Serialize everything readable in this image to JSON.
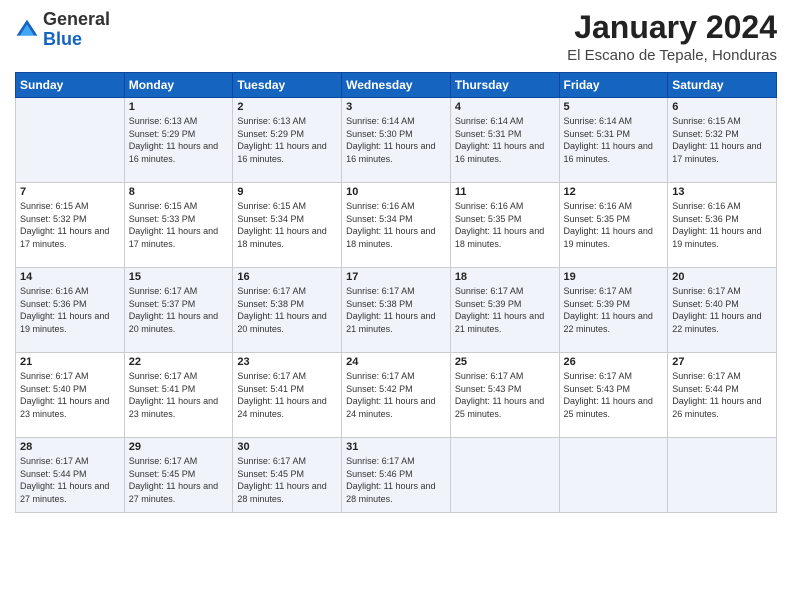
{
  "header": {
    "logo": {
      "general": "General",
      "blue": "Blue"
    },
    "title": "January 2024",
    "location": "El Escano de Tepale, Honduras"
  },
  "calendar": {
    "days_of_week": [
      "Sunday",
      "Monday",
      "Tuesday",
      "Wednesday",
      "Thursday",
      "Friday",
      "Saturday"
    ],
    "weeks": [
      [
        {
          "day": "",
          "sunrise": "",
          "sunset": "",
          "daylight": ""
        },
        {
          "day": "1",
          "sunrise": "Sunrise: 6:13 AM",
          "sunset": "Sunset: 5:29 PM",
          "daylight": "Daylight: 11 hours and 16 minutes."
        },
        {
          "day": "2",
          "sunrise": "Sunrise: 6:13 AM",
          "sunset": "Sunset: 5:29 PM",
          "daylight": "Daylight: 11 hours and 16 minutes."
        },
        {
          "day": "3",
          "sunrise": "Sunrise: 6:14 AM",
          "sunset": "Sunset: 5:30 PM",
          "daylight": "Daylight: 11 hours and 16 minutes."
        },
        {
          "day": "4",
          "sunrise": "Sunrise: 6:14 AM",
          "sunset": "Sunset: 5:31 PM",
          "daylight": "Daylight: 11 hours and 16 minutes."
        },
        {
          "day": "5",
          "sunrise": "Sunrise: 6:14 AM",
          "sunset": "Sunset: 5:31 PM",
          "daylight": "Daylight: 11 hours and 16 minutes."
        },
        {
          "day": "6",
          "sunrise": "Sunrise: 6:15 AM",
          "sunset": "Sunset: 5:32 PM",
          "daylight": "Daylight: 11 hours and 17 minutes."
        }
      ],
      [
        {
          "day": "7",
          "sunrise": "Sunrise: 6:15 AM",
          "sunset": "Sunset: 5:32 PM",
          "daylight": "Daylight: 11 hours and 17 minutes."
        },
        {
          "day": "8",
          "sunrise": "Sunrise: 6:15 AM",
          "sunset": "Sunset: 5:33 PM",
          "daylight": "Daylight: 11 hours and 17 minutes."
        },
        {
          "day": "9",
          "sunrise": "Sunrise: 6:15 AM",
          "sunset": "Sunset: 5:34 PM",
          "daylight": "Daylight: 11 hours and 18 minutes."
        },
        {
          "day": "10",
          "sunrise": "Sunrise: 6:16 AM",
          "sunset": "Sunset: 5:34 PM",
          "daylight": "Daylight: 11 hours and 18 minutes."
        },
        {
          "day": "11",
          "sunrise": "Sunrise: 6:16 AM",
          "sunset": "Sunset: 5:35 PM",
          "daylight": "Daylight: 11 hours and 18 minutes."
        },
        {
          "day": "12",
          "sunrise": "Sunrise: 6:16 AM",
          "sunset": "Sunset: 5:35 PM",
          "daylight": "Daylight: 11 hours and 19 minutes."
        },
        {
          "day": "13",
          "sunrise": "Sunrise: 6:16 AM",
          "sunset": "Sunset: 5:36 PM",
          "daylight": "Daylight: 11 hours and 19 minutes."
        }
      ],
      [
        {
          "day": "14",
          "sunrise": "Sunrise: 6:16 AM",
          "sunset": "Sunset: 5:36 PM",
          "daylight": "Daylight: 11 hours and 19 minutes."
        },
        {
          "day": "15",
          "sunrise": "Sunrise: 6:17 AM",
          "sunset": "Sunset: 5:37 PM",
          "daylight": "Daylight: 11 hours and 20 minutes."
        },
        {
          "day": "16",
          "sunrise": "Sunrise: 6:17 AM",
          "sunset": "Sunset: 5:38 PM",
          "daylight": "Daylight: 11 hours and 20 minutes."
        },
        {
          "day": "17",
          "sunrise": "Sunrise: 6:17 AM",
          "sunset": "Sunset: 5:38 PM",
          "daylight": "Daylight: 11 hours and 21 minutes."
        },
        {
          "day": "18",
          "sunrise": "Sunrise: 6:17 AM",
          "sunset": "Sunset: 5:39 PM",
          "daylight": "Daylight: 11 hours and 21 minutes."
        },
        {
          "day": "19",
          "sunrise": "Sunrise: 6:17 AM",
          "sunset": "Sunset: 5:39 PM",
          "daylight": "Daylight: 11 hours and 22 minutes."
        },
        {
          "day": "20",
          "sunrise": "Sunrise: 6:17 AM",
          "sunset": "Sunset: 5:40 PM",
          "daylight": "Daylight: 11 hours and 22 minutes."
        }
      ],
      [
        {
          "day": "21",
          "sunrise": "Sunrise: 6:17 AM",
          "sunset": "Sunset: 5:40 PM",
          "daylight": "Daylight: 11 hours and 23 minutes."
        },
        {
          "day": "22",
          "sunrise": "Sunrise: 6:17 AM",
          "sunset": "Sunset: 5:41 PM",
          "daylight": "Daylight: 11 hours and 23 minutes."
        },
        {
          "day": "23",
          "sunrise": "Sunrise: 6:17 AM",
          "sunset": "Sunset: 5:41 PM",
          "daylight": "Daylight: 11 hours and 24 minutes."
        },
        {
          "day": "24",
          "sunrise": "Sunrise: 6:17 AM",
          "sunset": "Sunset: 5:42 PM",
          "daylight": "Daylight: 11 hours and 24 minutes."
        },
        {
          "day": "25",
          "sunrise": "Sunrise: 6:17 AM",
          "sunset": "Sunset: 5:43 PM",
          "daylight": "Daylight: 11 hours and 25 minutes."
        },
        {
          "day": "26",
          "sunrise": "Sunrise: 6:17 AM",
          "sunset": "Sunset: 5:43 PM",
          "daylight": "Daylight: 11 hours and 25 minutes."
        },
        {
          "day": "27",
          "sunrise": "Sunrise: 6:17 AM",
          "sunset": "Sunset: 5:44 PM",
          "daylight": "Daylight: 11 hours and 26 minutes."
        }
      ],
      [
        {
          "day": "28",
          "sunrise": "Sunrise: 6:17 AM",
          "sunset": "Sunset: 5:44 PM",
          "daylight": "Daylight: 11 hours and 27 minutes."
        },
        {
          "day": "29",
          "sunrise": "Sunrise: 6:17 AM",
          "sunset": "Sunset: 5:45 PM",
          "daylight": "Daylight: 11 hours and 27 minutes."
        },
        {
          "day": "30",
          "sunrise": "Sunrise: 6:17 AM",
          "sunset": "Sunset: 5:45 PM",
          "daylight": "Daylight: 11 hours and 28 minutes."
        },
        {
          "day": "31",
          "sunrise": "Sunrise: 6:17 AM",
          "sunset": "Sunset: 5:46 PM",
          "daylight": "Daylight: 11 hours and 28 minutes."
        },
        {
          "day": "",
          "sunrise": "",
          "sunset": "",
          "daylight": ""
        },
        {
          "day": "",
          "sunrise": "",
          "sunset": "",
          "daylight": ""
        },
        {
          "day": "",
          "sunrise": "",
          "sunset": "",
          "daylight": ""
        }
      ]
    ]
  }
}
